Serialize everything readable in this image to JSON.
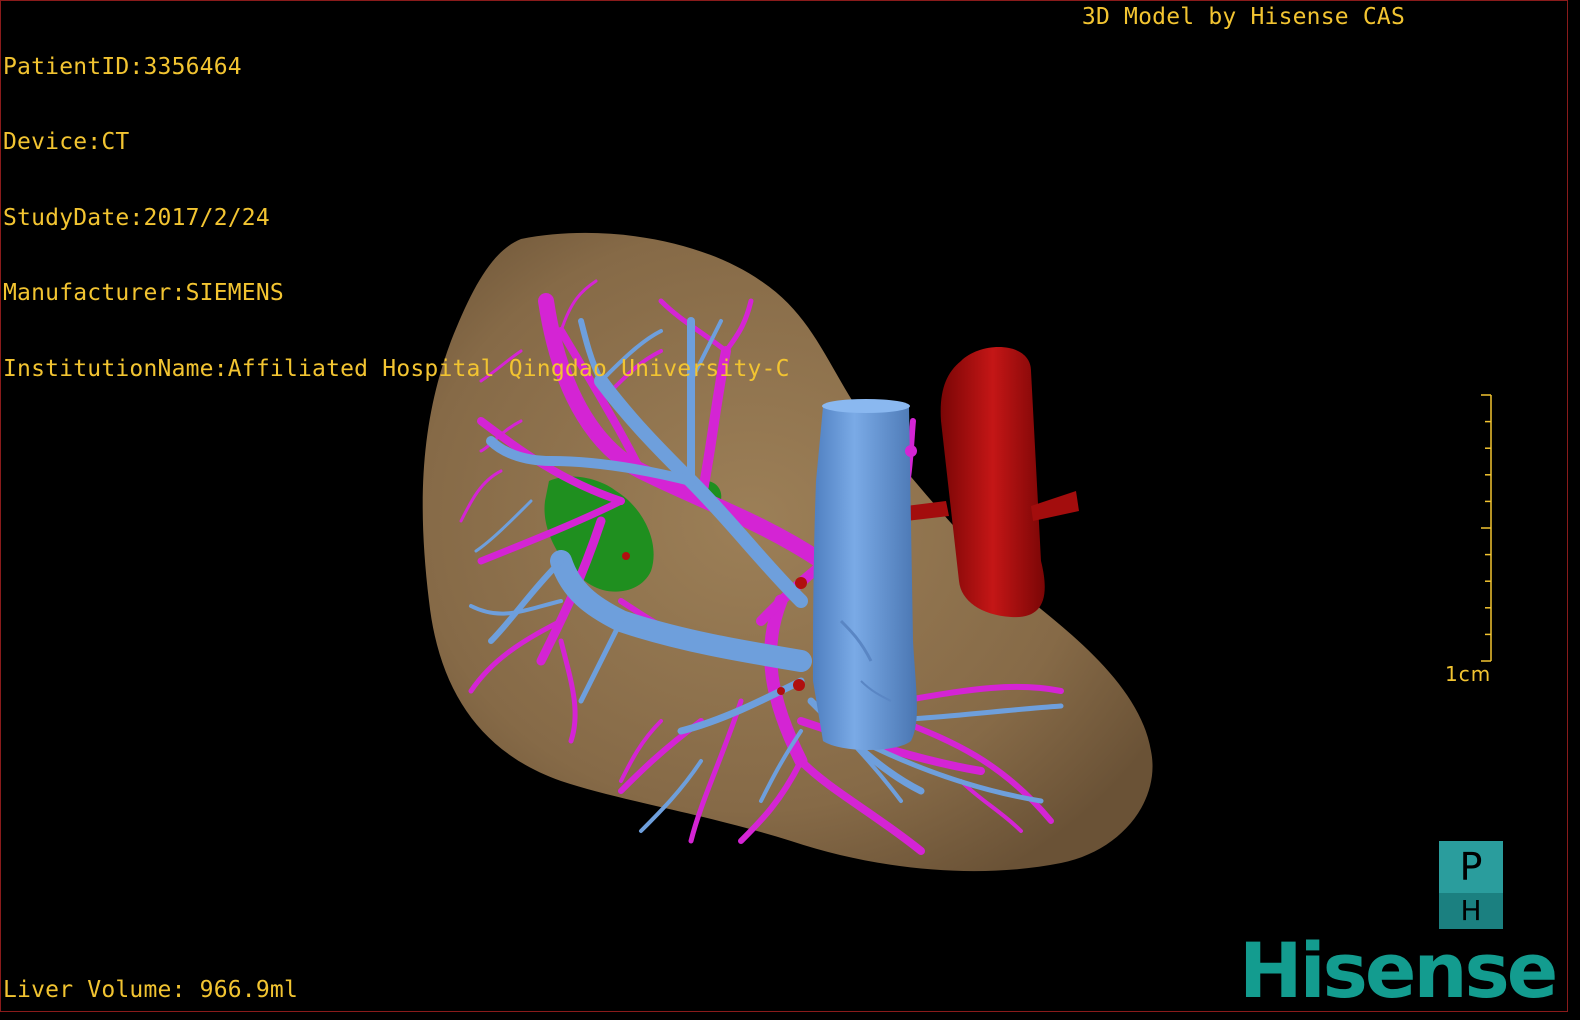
{
  "patient_info": {
    "patient_id": "PatientID:3356464",
    "device": "Device:CT",
    "study_date": "StudyDate:2017/2/24",
    "manufacturer": "Manufacturer:SIEMENS",
    "institution": "InstitutionName:Affiliated Hospital Qingdao University-C"
  },
  "credit": "3D Model by Hisense CAS",
  "liver_volume": "Liver Volume: 966.9ml",
  "scale": {
    "label": "1cm"
  },
  "orientation": {
    "top": "P",
    "bottom": "H"
  },
  "brand": "Hisense",
  "colors": {
    "overlay_text": "#f2c431",
    "liver": "#8a6e4a",
    "hepatic_vein": "#d424d4",
    "portal_vein": "#6e9fdc",
    "ivc": "#6e9fdc",
    "aorta": "#b00f0f",
    "lesion": "#1f8f1f",
    "brand": "#139c8f"
  }
}
